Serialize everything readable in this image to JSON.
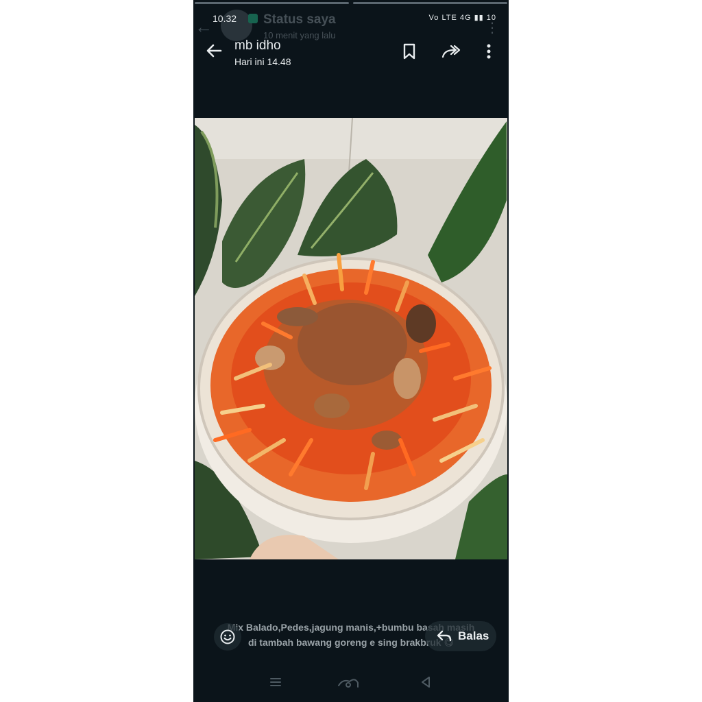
{
  "status_bar": {
    "time": "10.32",
    "right_icons": "Vo LTE 4G ▮▮ 10",
    "battery": "10"
  },
  "previous_status": {
    "title": "Status saya",
    "subtitle": "10 menit yang lalu"
  },
  "header": {
    "contact_name": "mb idho",
    "timestamp": "Hari ini 14.48",
    "icons": [
      "back-arrow-icon",
      "bookmark-icon",
      "forward-icon",
      "more-vert-icon"
    ]
  },
  "caption": {
    "line1": "Mix Balado,Pedes,jagung manis,+bumbu basah masih",
    "line2": "di tambah bawang goreng e sing brakbruk 😋"
  },
  "reply": {
    "label": "Balas"
  },
  "nav_icons": [
    "recents-icon",
    "home-icon",
    "back-triangle-icon"
  ],
  "colors": {
    "background": "#0b141a",
    "text": "#e9edef",
    "muted": "#8696a0",
    "status_accent": "#27c48f"
  }
}
